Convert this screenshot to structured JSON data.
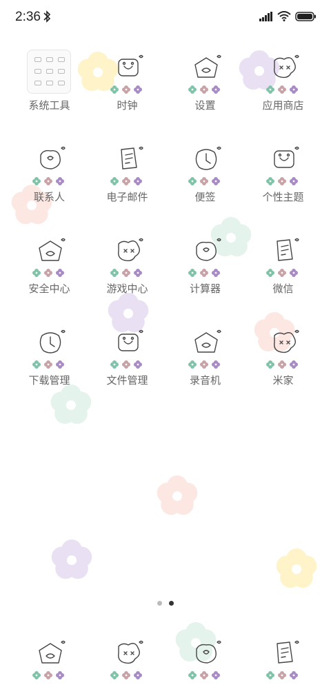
{
  "status_bar": {
    "time": "2:36"
  },
  "apps": [
    {
      "label": "系统工具",
      "icon": "folder-icon"
    },
    {
      "label": "时钟",
      "icon": "clock-icon"
    },
    {
      "label": "设置",
      "icon": "settings-icon"
    },
    {
      "label": "应用商店",
      "icon": "store-icon"
    },
    {
      "label": "联系人",
      "icon": "contacts-icon"
    },
    {
      "label": "电子邮件",
      "icon": "mail-icon"
    },
    {
      "label": "便签",
      "icon": "notes-icon"
    },
    {
      "label": "个性主题",
      "icon": "themes-icon"
    },
    {
      "label": "安全中心",
      "icon": "security-icon"
    },
    {
      "label": "游戏中心",
      "icon": "games-icon"
    },
    {
      "label": "计算器",
      "icon": "calculator-icon"
    },
    {
      "label": "微信",
      "icon": "wechat-icon"
    },
    {
      "label": "下载管理",
      "icon": "download-icon"
    },
    {
      "label": "文件管理",
      "icon": "files-icon"
    },
    {
      "label": "录音机",
      "icon": "recorder-icon"
    },
    {
      "label": "米家",
      "icon": "mihome-icon"
    }
  ],
  "dock": [
    {
      "icon": "phone-icon"
    },
    {
      "icon": "browser-icon"
    },
    {
      "icon": "gallery-icon"
    },
    {
      "icon": "messages-icon"
    }
  ],
  "pager": {
    "pages": 2,
    "current": 2
  },
  "colors": {
    "green": "#7fc3a8",
    "pink": "#c9a2a7",
    "purple": "#a88ac7"
  }
}
